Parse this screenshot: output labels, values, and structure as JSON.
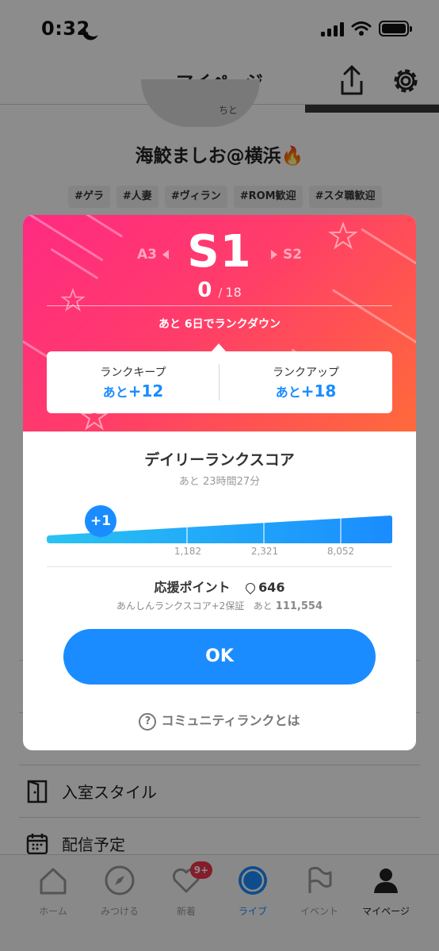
{
  "status_bar": {
    "time": "0:32"
  },
  "header": {
    "title": "マイページ"
  },
  "profile": {
    "avatar_text": "ちと",
    "name": "海鮫ましお@横浜🔥",
    "tags": [
      "#ゲラ",
      "#人妻",
      "#ヴィラン",
      "#ROM歓迎",
      "#スタ職歓迎"
    ]
  },
  "menu": {
    "items": [
      {
        "label": "入室スタイル",
        "icon": "door-icon"
      },
      {
        "label": "配信予定",
        "icon": "calendar-icon"
      }
    ]
  },
  "tabbar": {
    "tabs": [
      {
        "label": "ホーム",
        "icon": "home-icon"
      },
      {
        "label": "みつける",
        "icon": "compass-icon"
      },
      {
        "label": "新着",
        "icon": "heart-icon",
        "badge": "9+"
      },
      {
        "label": "ライブ",
        "icon": "live-icon"
      },
      {
        "label": "イベント",
        "icon": "flag-icon"
      },
      {
        "label": "マイページ",
        "icon": "person-icon"
      }
    ]
  },
  "modal": {
    "rank_prev": "A3",
    "rank_current": "S1",
    "rank_next": "S2",
    "score_current": "0",
    "score_sep": "/",
    "score_max": "18",
    "rankdown_text": "あと 6日でランクダウン",
    "keep": {
      "label": "ランクキープ",
      "prefix": "あと",
      "value": "+12"
    },
    "up": {
      "label": "ランクアップ",
      "prefix": "あと",
      "value": "+18"
    },
    "daily_title": "デイリーランクスコア",
    "daily_remaining": "あと 23時間27分",
    "meter": {
      "current_bubble": "+1",
      "current_position": 0.23,
      "ticks": [
        "1,182",
        "2,321",
        "8,052"
      ]
    },
    "support_label": "応援ポイント",
    "support_points": "646",
    "support_sub": "あんしんランクスコア+2保証",
    "support_sub_prefix": "あと",
    "support_sub_value": "111,554",
    "ok_label": "OK",
    "help_icon": "?",
    "help_label": "コミュニティランクとは"
  },
  "colors": {
    "accent": "#1a8cff",
    "hero_start": "#ff2a82",
    "hero_end": "#ff6a3a",
    "badge": "#f0344b"
  }
}
